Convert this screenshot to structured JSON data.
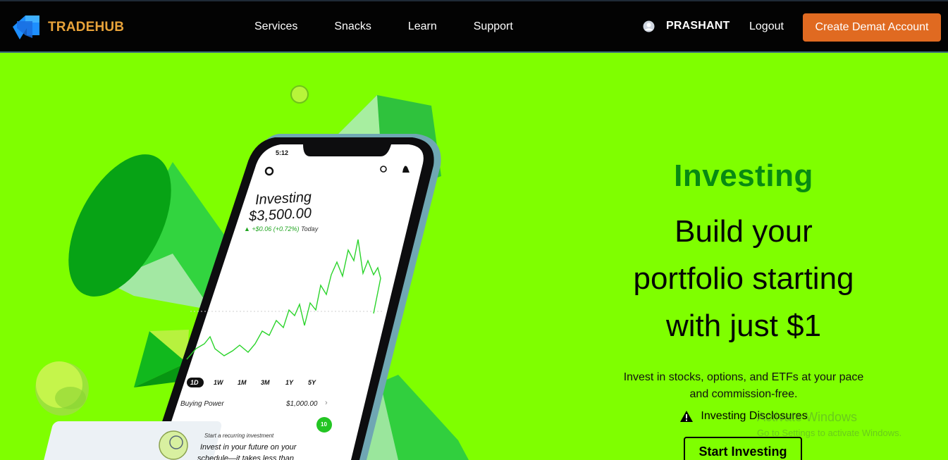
{
  "brand": {
    "name": "TRADEHUB",
    "logo_icon": "arrow-logo-icon"
  },
  "nav": {
    "links": [
      "Services",
      "Snacks",
      "Learn",
      "Support"
    ],
    "user_name": "PRASHANT",
    "logout_label": "Logout",
    "cta_label": "Create Demat Account"
  },
  "phone": {
    "time": "5:12",
    "title": "Investing",
    "amount": "$3,500.00",
    "change": "+$0.06 (+0.72%)",
    "change_period": "Today",
    "ranges": [
      "1D",
      "1W",
      "1M",
      "3M",
      "1Y",
      "5Y"
    ],
    "buying_power_label": "Buying Power",
    "buying_power_value": "$1,000.00",
    "card_title": "Start a recurring investment",
    "card_text": "Invest in your future on your",
    "card_text2": "schedule—it takes less than",
    "card_badge": "10"
  },
  "hero": {
    "eyebrow": "Investing",
    "headline_line1": "Build your",
    "headline_line2": "portfolio starting",
    "headline_line3": "with just $1",
    "sub_line1": "Invest in stocks, options, and ETFs at your pace",
    "sub_line2": "and commission-free.",
    "disclosure": "Investing Disclosures",
    "start_label": "Start Investing"
  },
  "watermark": {
    "title": "Activate Windows",
    "subtitle": "Go to Settings to activate Windows."
  },
  "colors": {
    "background": "#7fff00",
    "navbar": "#030303",
    "accent_orange": "#e06a21",
    "brand_gold": "#e8a33a",
    "eyebrow_green": "#078a12"
  }
}
